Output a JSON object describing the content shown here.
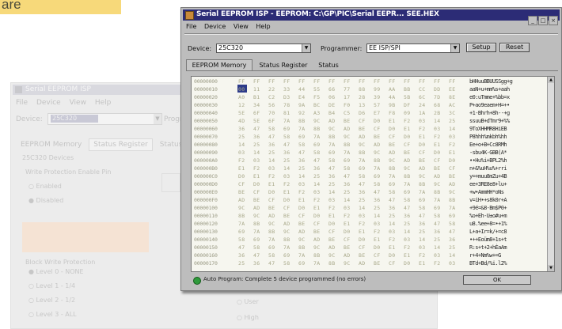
{
  "corner_label": "are",
  "background_window": {
    "title": "Serial EEPROM ISP",
    "menu": [
      "File",
      "Device",
      "View",
      "Help"
    ],
    "device_label": "Device:",
    "device_value": "25C320",
    "programmer_label": "Progr",
    "tabs": [
      "EEPROM Memory",
      "Status Register",
      "Status"
    ],
    "group_title": "25C320 Devices",
    "wp_label": "Write Protection Enable Pin",
    "radio_enabled": "Enabled",
    "radio_disabled": "Disabled",
    "block_title": "Block Write Protection",
    "levels": [
      "Level 0 - NONE",
      "Level 1 - 1/4",
      "Level 2 - 1/2",
      "Level 3 - ALL"
    ],
    "user_label": "User",
    "high_label": "High"
  },
  "window": {
    "title": "Serial EEPROM ISP - EEPROM: C:\\GP\\PIC\\Serial EEPR... SEE.HEX",
    "menu": [
      "File",
      "Device",
      "View",
      "Help"
    ],
    "device_label": "Device:",
    "device_value": "25C320",
    "programmer_label": "Programmer:",
    "programmer_value": "EE ISP/SPI",
    "setup_button": "Setup",
    "reset_button": "Reset",
    "tabs": [
      "EEPROM Memory",
      "Status Register",
      "Status"
    ],
    "status_text": "Auto Program: Complete 5 device programmed (no errors)",
    "ok_button": "OK"
  },
  "hex_rows": [
    {
      "addr": "00000000",
      "bytes": [
        "FF",
        "FF",
        "FF",
        "FF",
        "FF",
        "FF",
        "FF",
        "FF",
        "FF",
        "FF",
        "FF",
        "FF",
        "FF",
        "FF",
        "FF"
      ],
      "ascii": "bHHuuBBUUSSgg+g"
    },
    {
      "addr": "00000010",
      "bytes": [
        "00",
        "11",
        "22",
        "33",
        "44",
        "55",
        "66",
        "77",
        "88",
        "99",
        "AA",
        "BB",
        "CC",
        "DD",
        "EE"
      ],
      "ascii": "aaN+u+mm%s+aah"
    },
    {
      "addr": "00000020",
      "bytes": [
        "A0",
        "B1",
        "C2",
        "D3",
        "E4",
        "F5",
        "06",
        "17",
        "28",
        "39",
        "4A",
        "5B",
        "6C",
        "7D",
        "8E"
      ],
      "ascii": "e0:uTmme+%bb=x"
    },
    {
      "addr": "00000030",
      "bytes": [
        "12",
        "34",
        "56",
        "78",
        "9A",
        "BC",
        "DE",
        "F0",
        "13",
        "57",
        "9B",
        "DF",
        "24",
        "68",
        "AC"
      ],
      "ascii": "P+ao9eaem+H=+•"
    },
    {
      "addr": "00000040",
      "bytes": [
        "5E",
        "6F",
        "70",
        "81",
        "92",
        "A3",
        "B4",
        "C5",
        "D6",
        "E7",
        "F8",
        "09",
        "1A",
        "2B",
        "3C"
      ],
      "ascii": "+1-Bhrh+8h--+g"
    },
    {
      "addr": "00000050",
      "bytes": [
        "4D",
        "5E",
        "6F",
        "7A",
        "8B",
        "9C",
        "AD",
        "BE",
        "CF",
        "D0",
        "E1",
        "F2",
        "03",
        "14",
        "25"
      ],
      "ascii": "ssuuB+dTmr9+%%"
    },
    {
      "addr": "00000060",
      "bytes": [
        "36",
        "47",
        "58",
        "69",
        "7A",
        "8B",
        "9C",
        "AD",
        "BE",
        "CF",
        "D0",
        "E1",
        "F2",
        "03",
        "14"
      ],
      "ascii": "9ToXHHMR8HiEB"
    },
    {
      "addr": "00000070",
      "bytes": [
        "25",
        "36",
        "47",
        "58",
        "69",
        "7A",
        "8B",
        "9C",
        "AD",
        "BE",
        "CF",
        "D0",
        "E1",
        "F2",
        "03"
      ],
      "ascii": "P8hhh%mkbh%hh"
    },
    {
      "addr": "00000080",
      "bytes": [
        "14",
        "25",
        "36",
        "47",
        "58",
        "69",
        "7A",
        "8B",
        "9C",
        "AD",
        "BE",
        "CF",
        "D0",
        "E1",
        "F2"
      ],
      "ascii": "Ee+o+B+Cc8RMh"
    },
    {
      "addr": "00000090",
      "bytes": [
        "03",
        "14",
        "25",
        "36",
        "47",
        "58",
        "69",
        "7A",
        "8B",
        "9C",
        "AD",
        "BE",
        "CF",
        "D0",
        "E1"
      ],
      "ascii": "-sbu4K-GBB(A*"
    },
    {
      "addr": "000000A0",
      "bytes": [
        "F2",
        "03",
        "14",
        "25",
        "36",
        "47",
        "58",
        "69",
        "7A",
        "8B",
        "9C",
        "AD",
        "BE",
        "CF",
        "D0"
      ],
      "ascii": "••Hu%i+BPL2%h"
    },
    {
      "addr": "000000B0",
      "bytes": [
        "E1",
        "F2",
        "03",
        "14",
        "25",
        "36",
        "47",
        "58",
        "69",
        "7A",
        "8B",
        "9C",
        "AD",
        "BE",
        "CF"
      ],
      "ascii": "n+&%uH%u%+rri"
    },
    {
      "addr": "000000C0",
      "bytes": [
        "D0",
        "E1",
        "F2",
        "03",
        "14",
        "25",
        "36",
        "47",
        "58",
        "69",
        "7A",
        "8B",
        "9C",
        "AD",
        "BE"
      ],
      "ascii": "y=+muu8mZu+4B"
    },
    {
      "addr": "000000D0",
      "bytes": [
        "CF",
        "D0",
        "E1",
        "F2",
        "03",
        "14",
        "25",
        "36",
        "47",
        "58",
        "69",
        "7A",
        "8B",
        "9C",
        "AD"
      ],
      "ascii": "ee+3RE8e8+lu+"
    },
    {
      "addr": "000000E0",
      "bytes": [
        "BE",
        "CF",
        "D0",
        "E1",
        "F2",
        "03",
        "14",
        "25",
        "36",
        "47",
        "58",
        "69",
        "7A",
        "8B",
        "9C"
      ],
      "ascii": "+w•AmmHH*oNs"
    },
    {
      "addr": "000000F0",
      "bytes": [
        "AD",
        "BE",
        "CF",
        "D0",
        "E1",
        "F2",
        "03",
        "14",
        "25",
        "36",
        "47",
        "58",
        "69",
        "7A",
        "8B"
      ],
      "ascii": "v=iH•+s8k0r+A"
    },
    {
      "addr": "00000100",
      "bytes": [
        "9C",
        "AD",
        "BE",
        "CF",
        "D0",
        "E1",
        "F2",
        "03",
        "14",
        "25",
        "36",
        "47",
        "58",
        "69",
        "7A"
      ],
      "ascii": "+9é=&8-Bm$P0+"
    },
    {
      "addr": "00000110",
      "bytes": [
        "8B",
        "9C",
        "AD",
        "BE",
        "CF",
        "D0",
        "E1",
        "F2",
        "03",
        "14",
        "25",
        "36",
        "47",
        "58",
        "69"
      ],
      "ascii": "%o+Eh-U±o#u+m"
    },
    {
      "addr": "00000120",
      "bytes": [
        "7A",
        "8B",
        "9C",
        "AD",
        "BE",
        "CF",
        "D0",
        "E1",
        "F2",
        "03",
        "14",
        "25",
        "36",
        "47",
        "58"
      ],
      "ascii": "u8.%ee+8=•+1%"
    },
    {
      "addr": "00000130",
      "bytes": [
        "69",
        "7A",
        "8B",
        "9C",
        "AD",
        "BE",
        "CF",
        "D0",
        "E1",
        "F2",
        "03",
        "14",
        "25",
        "36",
        "47"
      ],
      "ascii": "L+a+Ir=k/+=c8"
    },
    {
      "addr": "00000140",
      "bytes": [
        "58",
        "69",
        "7A",
        "8B",
        "9C",
        "AD",
        "BE",
        "CF",
        "D0",
        "E1",
        "F2",
        "03",
        "14",
        "25",
        "36"
      ],
      "ascii": "•++Eoüm8+1s+t"
    },
    {
      "addr": "00000150",
      "bytes": [
        "47",
        "58",
        "69",
        "7A",
        "8B",
        "9C",
        "AD",
        "BE",
        "CF",
        "D0",
        "E1",
        "F2",
        "03",
        "14",
        "25"
      ],
      "ascii": "R:s+t+2+hÈaAm"
    },
    {
      "addr": "00000160",
      "bytes": [
        "36",
        "47",
        "58",
        "69",
        "7A",
        "8B",
        "9C",
        "AD",
        "BE",
        "CF",
        "D0",
        "E1",
        "F2",
        "03",
        "14"
      ],
      "ascii": "r+4+Nm%w+=G"
    },
    {
      "addr": "00000170",
      "bytes": [
        "25",
        "36",
        "47",
        "58",
        "69",
        "7A",
        "8B",
        "9C",
        "AD",
        "BE",
        "CF",
        "D0",
        "E1",
        "F2",
        "03"
      ],
      "ascii": "BTd+Bd/%i.l2%"
    }
  ]
}
